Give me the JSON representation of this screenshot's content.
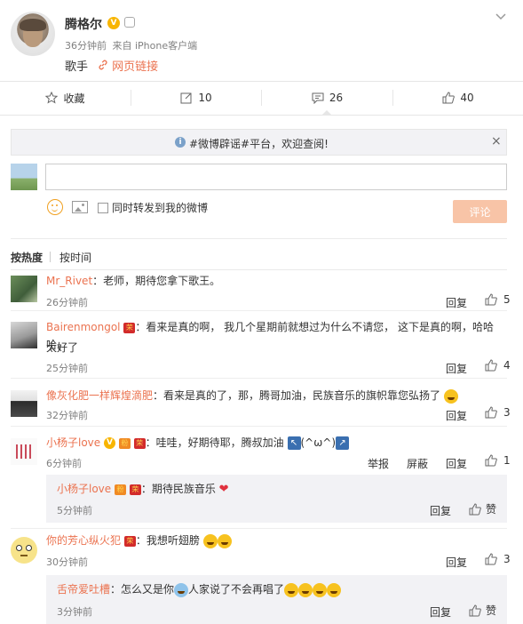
{
  "post": {
    "author": "腾格尔",
    "time": "36分钟前",
    "source": "来自 iPhone客户端",
    "text": "歌手",
    "link_label": "网页链接"
  },
  "actions": {
    "favorite": "收藏",
    "repost": "10",
    "comment": "26",
    "like": "40"
  },
  "notice": {
    "text": "#微博辟谣#平台，欢迎查阅!",
    "close": "×"
  },
  "composer": {
    "placeholder": "",
    "repost_label": "同时转发到我的微博",
    "submit": "评论"
  },
  "sort": {
    "hot": "按热度",
    "time": "按时间"
  },
  "comments": [
    {
      "name": "Mr_Rivet",
      "text": "：老师，期待您拿下歌王。",
      "time": "26分钟前",
      "reply": "回复",
      "likes": "5"
    },
    {
      "name": "Bairenmongol",
      "text": "：看来是真的啊， 我几个星期前就想过为什么不请您， 这下是真的啊，哈哈哈，",
      "text2": "太好了",
      "time": "25分钟前",
      "reply": "回复",
      "likes": "4"
    },
    {
      "name": "像灰化肥一样辉煌滴肥",
      "text": "：看来是真的了，那，腾哥加油，民族音乐的旗帜靠您弘扬了",
      "time": "32分钟前",
      "reply": "回复",
      "likes": "3"
    },
    {
      "name": "小杨子love",
      "text": "：哇哇，好期待耶，腾叔加油",
      "text_tail": "(^ω^)",
      "time": "6分钟前",
      "report": "举报",
      "block": "屏蔽",
      "reply": "回复",
      "likes": "1",
      "sub": {
        "name": "小杨子love",
        "text": "：期待民族音乐",
        "time": "5分钟前",
        "reply": "回复",
        "like_label": "赞"
      }
    },
    {
      "name": "你的芳心纵火犯",
      "text": "：我想听翅膀",
      "time": "30分钟前",
      "reply": "回复",
      "likes": "3",
      "sub": {
        "name": "舌帝爱吐槽",
        "text": "：怎么又是你",
        "text_tail": "人家说了不会再唱了",
        "time": "3分钟前",
        "reply": "回复",
        "like_label": "赞"
      }
    }
  ]
}
